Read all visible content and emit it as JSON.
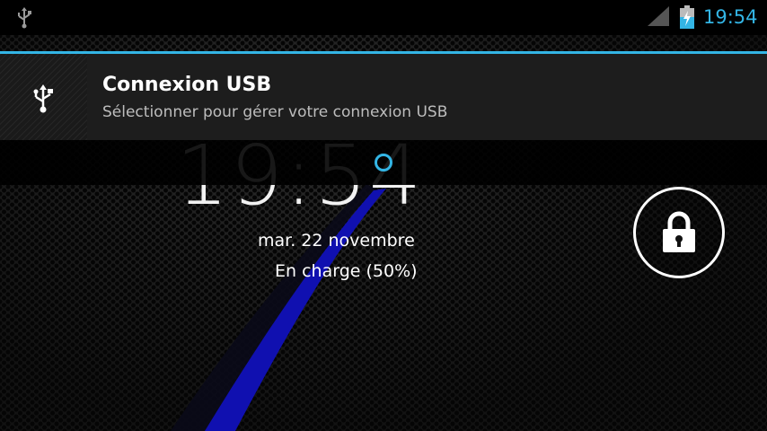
{
  "status_bar": {
    "time": "19:54",
    "icons": [
      "usb-icon",
      "signal-icon",
      "battery-charging-icon"
    ],
    "accent_color": "#33b5e5"
  },
  "notification": {
    "icon": "usb-icon",
    "title": "Connexion USB",
    "text": "Sélectionner pour gérer votre connexion USB"
  },
  "lockscreen": {
    "clock": "19:54",
    "date": "mar. 22 novembre",
    "charging": "En charge (50%)",
    "unlock_icon": "lock-icon"
  }
}
